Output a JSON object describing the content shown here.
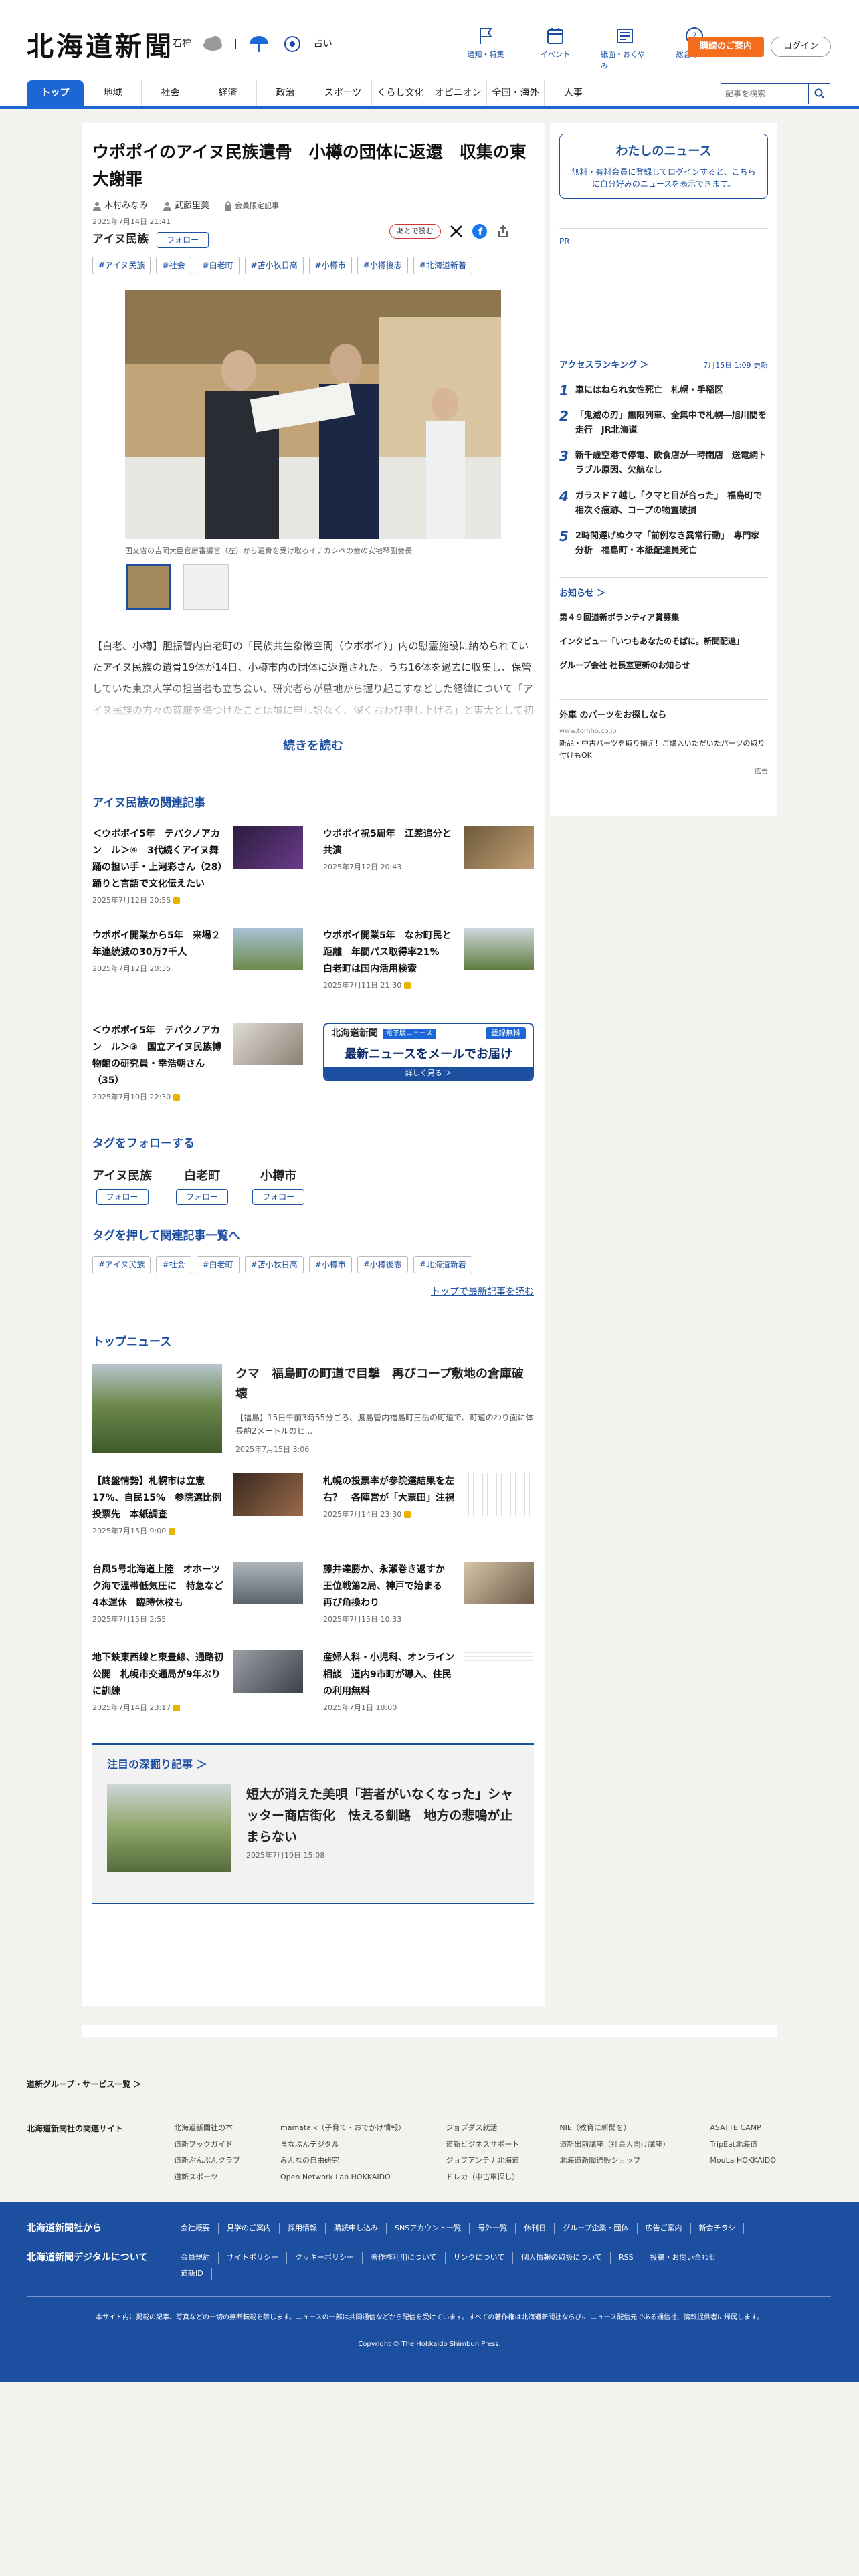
{
  "header": {
    "logo": "北海道新聞",
    "weather": {
      "place": "石狩",
      "sep": "|",
      "more": "占い"
    },
    "icons": [
      {
        "label": "通知・特集",
        "icon": "flag-icon"
      },
      {
        "label": "イベント",
        "icon": "calendar-icon"
      },
      {
        "label": "紙面・おくやみ",
        "icon": "newspaper-icon"
      },
      {
        "label": "総合ガイド",
        "icon": "help-icon"
      }
    ],
    "subscribe": "購読のご案内",
    "login": "ログイン",
    "nav": [
      "トップ",
      "地域",
      "社会",
      "経済",
      "政治",
      "スポーツ",
      "くらし文化",
      "オピニオン",
      "全国・海外",
      "人事"
    ],
    "search_placeholder": "記事を検索"
  },
  "article": {
    "title": "ウポポイのアイヌ民族遺骨　小樽の団体に返還　収集の東大謝罪",
    "authors": [
      "木村みなみ",
      "武藤里美"
    ],
    "membership": "会員限定記事",
    "date": "2025年7月14日 21:41",
    "later": "あとで読む",
    "topic": "アイヌ民族",
    "follow": "フォロー",
    "tags": [
      "#アイヌ民族",
      "#社会",
      "#白老町",
      "#苫小牧日高",
      "#小樽市",
      "#小樽後志",
      "#北海道新着"
    ],
    "caption": "国交省の吉岡大臣官房審議官（左）から遺骨を受け取るイチカシペの会の安宅琴副会長",
    "body": "【白老、小樽】胆振管内白老町の「民族共生象徴空間（ウポポイ）」内の慰霊施設に納められていたアイヌ民族の遺骨19体が14日、小樽市内の団体に返還された。うち16体を過去に収集し、保管していた東京大学の担当者も立ち会い、研究者らが墓地から掘り起こすなどした経緯について「アイヌ民族の方々の尊厳を傷つけたことは誠に申し訳なく、深くおわび申し上げる」と東大として初めて謝罪した。...",
    "read_more": "続きを読む"
  },
  "related": {
    "heading": "アイヌ民族の関連記事",
    "items": [
      {
        "title": "＜ウポポイ5年　テパクノアカン　ル＞④　3代続くアイヌ舞踊の担い手・上河彩さん（28）　踊りと言語で文化伝えたい",
        "date": "2025年7月12日 20:55",
        "locked": true
      },
      {
        "title": "ウポポイ祝5周年　江差追分と共演",
        "date": "2025年7月12日 20:43",
        "locked": false
      },
      {
        "title": "ウポポイ開業から5年　来場２年連続減の30万7千人",
        "date": "2025年7月12日 20:35",
        "locked": false
      },
      {
        "title": "ウポポイ開業5年　なお町民と距離　年間パス取得率21%　白老町は国内活用検索",
        "date": "2025年7月11日 21:30",
        "locked": true
      },
      {
        "title": "＜ウポポイ5年　テパクノアカン　ル＞③　国立アイヌ民族博物館の研究員・幸浩朝さん（35）",
        "date": "2025年7月10日 22:30",
        "locked": true
      }
    ],
    "mail": {
      "logo": "北海道新聞",
      "sub": "電子版ニュース",
      "free": "登録無料",
      "text": "最新ニュースをメールでお届け",
      "btn": "詳しく見る ＞"
    }
  },
  "follow_tags": {
    "heading": "タグをフォローする",
    "tags": [
      "アイヌ民族",
      "白老町",
      "小樽市"
    ],
    "follow": "フォロー",
    "list_heading": "タグを押して関連記事一覧へ",
    "list": [
      "#アイヌ民族",
      "#社会",
      "#白老町",
      "#苫小牧日高",
      "#小樽市",
      "#小樽後志",
      "#北海道新着"
    ],
    "more": "トップで最新記事を読む"
  },
  "top_news": {
    "heading": "トップニュース",
    "lead": {
      "title": "クマ　福島町の町道で目撃　再びコープ敷地の倉庫破壊",
      "text": "【福島】15日午前3時55分ごろ、渡島管内福島町三岳の町道で、町道のわり面に体長約2メートルのヒ...",
      "date": "2025年7月15日 3:06"
    },
    "items": [
      {
        "title": "【終盤情勢】札幌市は立憲17%、自民15%　参院選比例投票先　本紙調査",
        "date": "2025年7月15日 9:00",
        "locked": true
      },
      {
        "title": "札幌の投票率が参院選結果を左右？　各陣営が「大票田」注視",
        "date": "2025年7月14日 23:30",
        "locked": true
      },
      {
        "title": "台風5号北海道上陸　オホーツク海で温帯低気圧に　特急など4本運休　臨時休校も",
        "date": "2025年7月15日 2:55",
        "locked": false
      },
      {
        "title": "藤井達勝か、永瀬巻き返すか　王位戦第2局、神戸で始まる　再び角換わり",
        "date": "2025年7月15日 10:33",
        "locked": false
      },
      {
        "title": "地下鉄東西線と東豊線、通路初公開　札幌市交通局が9年ぶりに訓練",
        "date": "2025年7月14日 23:17",
        "locked": true
      },
      {
        "title": "産婦人科・小児科、オンライン相談　道内9市町が導入、住民の利用無料",
        "date": "2025年7月1日 18:00",
        "locked": false
      }
    ]
  },
  "deep": {
    "heading": "注目の深掘り記事",
    "title": "短大が消えた美唄「若者がいなくなった」シャッター商店街化　怯える釧路　地方の悲鳴が止まらない",
    "date": "2025年7月10日 15:08"
  },
  "sidebar": {
    "mynews_title": "わたしのニュース",
    "mynews_text": "無料・有料会員に登録してログインすると、こちらに自分好みのニュースを表示できます。",
    "pr": "PR",
    "rank_heading": "アクセスランキング",
    "rank_updated": "7月15日 1:09 更新",
    "ranking": [
      "車にはねられ女性死亡　札幌・手稲区",
      "「鬼滅の刃」無限列車、全集中で札幌―旭川間を走行　JR北海道",
      "新千歳空港で停電、飲食店が一時閉店　送電網トラブル原因、欠航なし",
      "ガラスド７越し「クマと目が合った」　福島町で相次ぐ痕跡、コープの物置破損",
      "2時間遅げぬクマ「前例なき異常行動」　専門家分析　福島町・本紙配達員死亡"
    ],
    "notice_heading": "お知らせ",
    "notices": [
      "第４９回道新ボランティア賞募集",
      "インタビュー「いつもあなたのそばに。新聞配達」",
      "グループ会社 社長室更新のお知らせ"
    ],
    "ad": {
      "title": "外車 のパーツをお探しなら",
      "url": "www.tomho.co.jp",
      "text": "新品・中古パーツを取り揃え！ご購入いただいたパーツの取り付けもOK",
      "label": "広告"
    }
  },
  "footer": {
    "group": "道新グループ・サービス一覧",
    "related_heading": "北海道新聞社の関連サイト",
    "sites": [
      [
        "北海道新聞社の本",
        "道新ブックガイド",
        "道新ぶんぶんクラブ",
        "道新スポーツ"
      ],
      [
        "mamatalk（子育て・おでかけ情報）",
        "まなぶんデジタル",
        "みんなの自由研究",
        "Open Network Lab HOKKAIDO"
      ],
      [
        "ジョブダス就活",
        "道新ビジネスサポート",
        "ジョブアンテナ北海道",
        "ドレカ（中古車探し）"
      ],
      [
        "NIE（教育に新聞を）",
        "道新出前講座（社会人向け講座）",
        "北海道新聞通販ショップ"
      ],
      [
        "ASATTE CAMP",
        "TripEat北海道",
        "MouLa HOKKAIDO"
      ]
    ],
    "company": "北海道新聞社から",
    "company_links": [
      "会社概要",
      "見学のご案内",
      "採用情報",
      "購読申し込み",
      "SNSアカウント一覧",
      "号外一覧",
      "休刊日",
      "グループ企業・団体",
      "広告ご案内",
      "新会チラシ"
    ],
    "digital": "北海道新聞デジタルについて",
    "digital_links": [
      "会員規約",
      "サイトポリシー",
      "クッキーポリシー",
      "著作権利用について",
      "リンクについて",
      "個人情報の取扱について",
      "RSS",
      "投稿・お問い合わせ",
      "道新ID"
    ],
    "note": "本サイト内に掲載の記事、写真などの一切の無断転載を禁じます。ニュースの一部は共同通信などから配信を受けています。すべての著作権は北海道新聞社ならびに ニュース配信元である通信社、情報提供者に帰属します。",
    "copyright": "Copyright © The Hokkaido Shimbun Press."
  }
}
